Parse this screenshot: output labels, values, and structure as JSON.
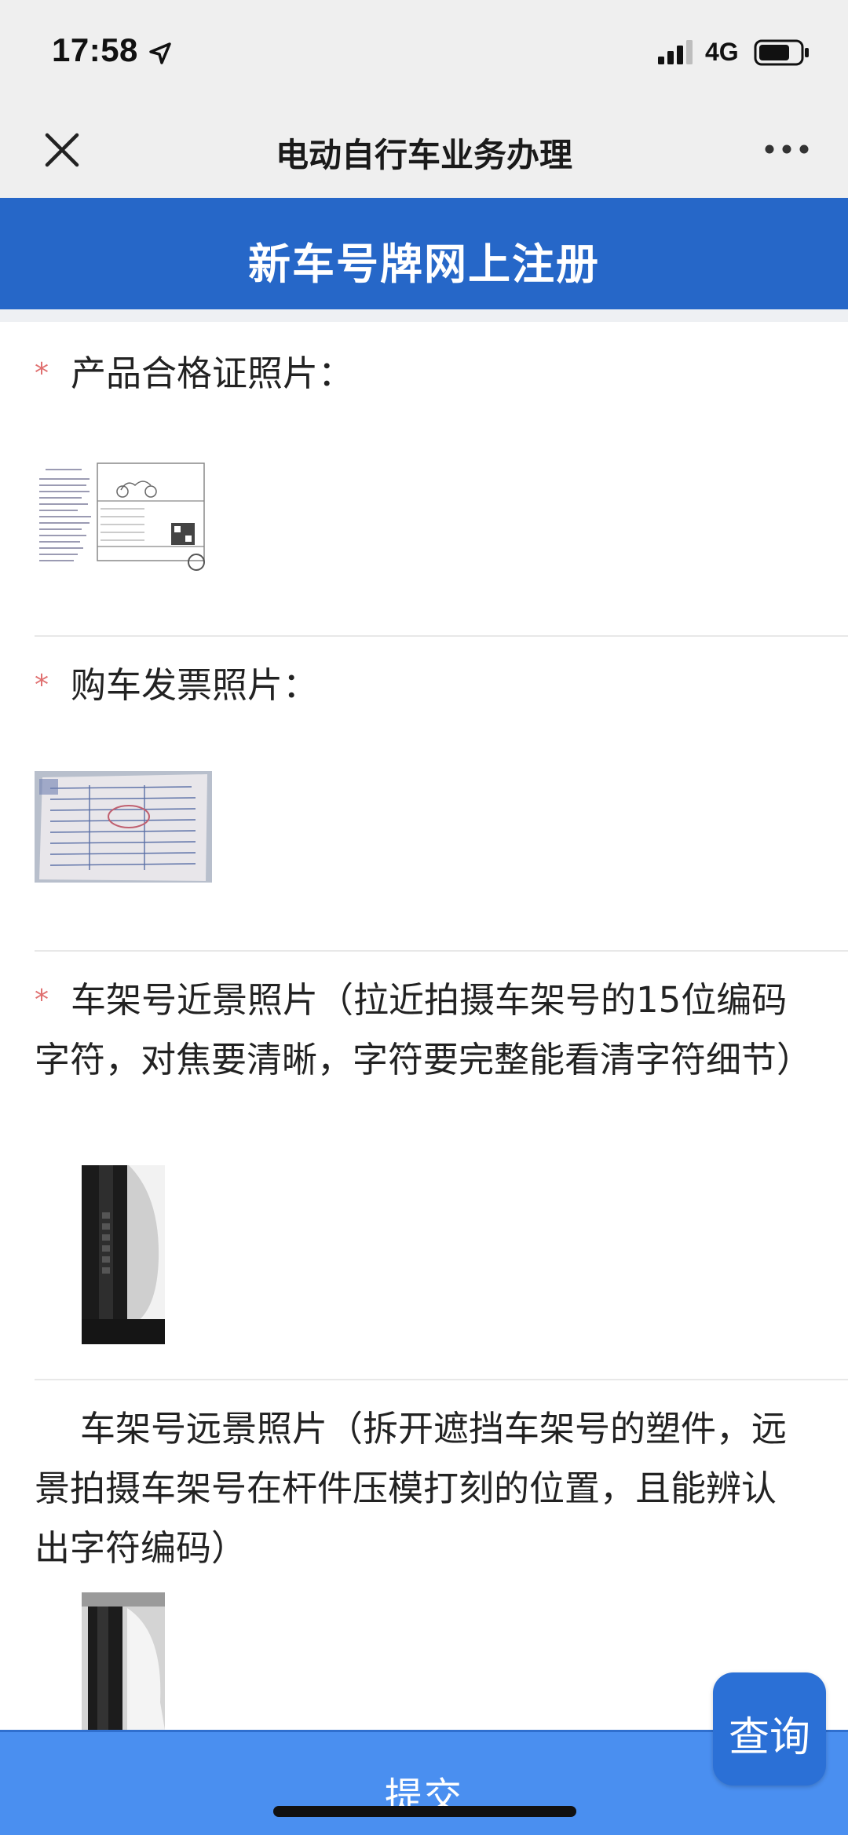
{
  "status_bar": {
    "time": "17:58",
    "network": "4G"
  },
  "nav": {
    "title": "电动自行车业务办理"
  },
  "header": {
    "title": "新车号牌网上注册"
  },
  "sections": [
    {
      "required": "*",
      "label": "产品合格证照片：",
      "photo": "合格证照片"
    },
    {
      "required": "*",
      "label": "购车发票照片：",
      "photo": "发票照片"
    },
    {
      "required": "*",
      "label": "车架号近景照片（拉近拍摄车架号的15位编码字符，对焦要清晰，字符要完整能看清字符细节）",
      "photo": "车架号近景照片"
    },
    {
      "required": "",
      "label": "车架号远景照片（拆开遮挡车架号的塑件，远景拍摄车架号在杆件压模打刻的位置，且能辨认出字符编码）",
      "photo": "车架号远景照片"
    }
  ],
  "actions": {
    "submit_label": "提交",
    "query_label": "查询"
  },
  "colors": {
    "header_blue": "#2667c8",
    "submit_blue": "#4a8ff0",
    "required_star": "#e07070"
  },
  "icons": {
    "close": "close-icon",
    "more": "more-icon",
    "location": "location-arrow-icon",
    "signal": "signal-icon",
    "battery": "battery-icon"
  }
}
